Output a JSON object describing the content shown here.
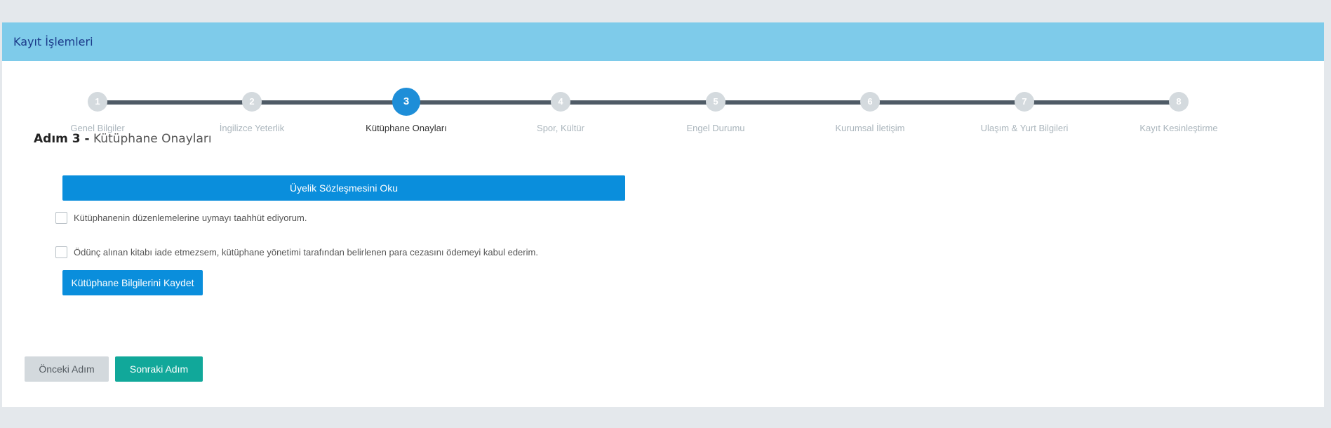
{
  "panel": {
    "title": "Kayıt İşlemleri"
  },
  "stepper": {
    "active_step": 3,
    "steps": [
      {
        "number": "1",
        "label": "Genel Bilgiler"
      },
      {
        "number": "2",
        "label": "İngilizce Yeterlik"
      },
      {
        "number": "3",
        "label": "Kütüphane Onayları"
      },
      {
        "number": "4",
        "label": "Spor, Kültür"
      },
      {
        "number": "5",
        "label": "Engel Durumu"
      },
      {
        "number": "6",
        "label": "Kurumsal İletişim"
      },
      {
        "number": "7",
        "label": "Ulaşım & Yurt Bilgileri"
      },
      {
        "number": "8",
        "label": "Kayıt Kesinleştirme"
      }
    ]
  },
  "step_heading": {
    "number": "Adım 3 -",
    "title": "Kütüphane Onayları"
  },
  "library": {
    "read_contract_label": "Üyelik Sözleşmesini Oku",
    "checks": [
      {
        "label": "Kütüphanenin düzenlemelerine uymayı taahhüt ediyorum.",
        "checked": false
      },
      {
        "label": "Ödünç alınan kitabı iade etmezsem, kütüphane yönetimi tarafından belirlenen para cezasını ödemeyi kabul ederim.",
        "checked": false
      }
    ],
    "save_label": "Kütüphane Bilgilerini Kaydet"
  },
  "nav": {
    "prev_label": "Önceki Adım",
    "next_label": "Sonraki Adım"
  },
  "colors": {
    "header": "#7ecbea",
    "primary": "#0a8edc",
    "success": "#11a89a",
    "inactive_step": "#d4dade"
  }
}
